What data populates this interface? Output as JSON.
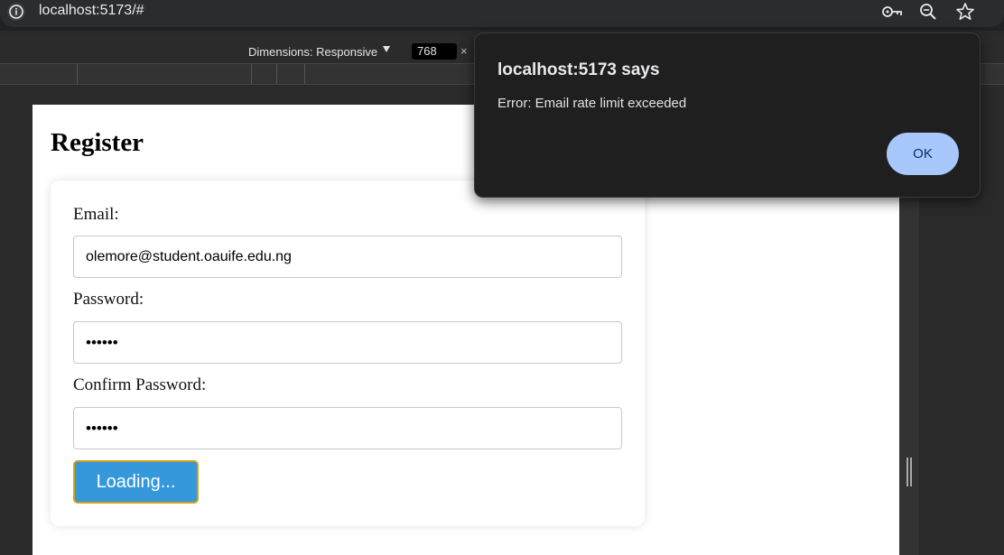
{
  "browser": {
    "url": "localhost:5173/#",
    "icons": [
      "info-icon",
      "key-icon",
      "zoom-icon",
      "star-icon"
    ]
  },
  "devtools": {
    "dimensions_label": "Dimensions: Responsive",
    "width_value": "768",
    "close_glyph": "×"
  },
  "page": {
    "title": "Register",
    "form": {
      "email_label": "Email:",
      "email_value": "olemore@student.oauife.edu.ng",
      "password_label": "Password:",
      "password_value": "••••••",
      "confirm_label": "Confirm Password:",
      "confirm_value": "••••••",
      "submit_label": "Loading..."
    }
  },
  "alert": {
    "title": "localhost:5173 says",
    "message": "Error: Email rate limit exceeded",
    "ok_label": "OK"
  },
  "colors": {
    "button": "#3498db",
    "button_border": "#d4a017",
    "ok_button": "#a8c7fa",
    "dialog_bg": "#1f1f1f"
  }
}
